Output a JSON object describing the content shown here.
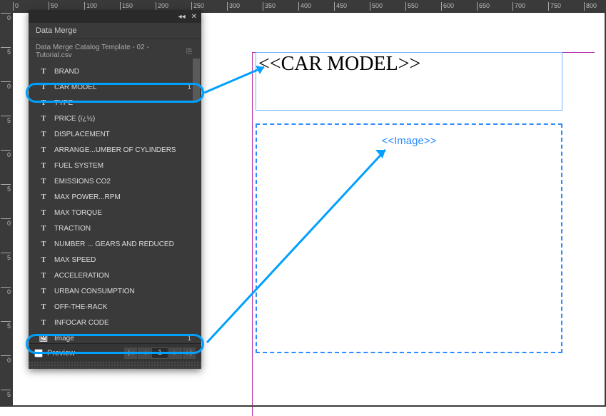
{
  "panel": {
    "title": "Data Merge",
    "source": "Data Merge Catalog Template - 02 - Tutorial.csv",
    "menu_icon": "▾≡",
    "close_icon": "✕",
    "collapse_icon": "◂◂",
    "source_icon": "⎘"
  },
  "fields": [
    {
      "type": "text",
      "label": "BRAND",
      "count": ""
    },
    {
      "type": "text",
      "label": "CAR MODEL",
      "count": "1"
    },
    {
      "type": "text",
      "label": "TYPE",
      "count": ""
    },
    {
      "type": "text",
      "label": "PRICE (ï¿½)",
      "count": ""
    },
    {
      "type": "text",
      "label": "DISPLACEMENT",
      "count": ""
    },
    {
      "type": "text",
      "label": "ARRANGE...UMBER OF CYLINDERS",
      "count": ""
    },
    {
      "type": "text",
      "label": "FUEL SYSTEM",
      "count": ""
    },
    {
      "type": "text",
      "label": "EMISSIONS CO2",
      "count": ""
    },
    {
      "type": "text",
      "label": "MAX POWER...RPM",
      "count": ""
    },
    {
      "type": "text",
      "label": "MAX TORQUE",
      "count": ""
    },
    {
      "type": "text",
      "label": "TRACTION",
      "count": ""
    },
    {
      "type": "text",
      "label": "NUMBER ... GEARS AND REDUCED",
      "count": ""
    },
    {
      "type": "text",
      "label": "MAX SPEED",
      "count": ""
    },
    {
      "type": "text",
      "label": "ACCELERATION",
      "count": ""
    },
    {
      "type": "text",
      "label": "URBAN CONSUMPTION",
      "count": ""
    },
    {
      "type": "text",
      "label": "OFF-THE-RACK",
      "count": ""
    },
    {
      "type": "text",
      "label": "INFOCAR CODE",
      "count": ""
    },
    {
      "type": "image",
      "label": "Image",
      "count": "1"
    }
  ],
  "footer": {
    "preview_label": "Preview",
    "nav_first": "|◂",
    "nav_prev": "◂",
    "page": "1",
    "nav_next": "▸",
    "nav_last": "▸|"
  },
  "ruler_h": [
    "0",
    "50",
    "100",
    "150",
    "200",
    "250",
    "300",
    "350",
    "400",
    "450",
    "500",
    "550",
    "600",
    "650",
    "700",
    "750",
    "800"
  ],
  "ruler_v": [
    "0",
    "5",
    "0",
    "5",
    "0",
    "5",
    "0",
    "5",
    "0",
    "5",
    "0",
    "5"
  ],
  "canvas": {
    "placeholder_text": "<<CAR MODEL>>",
    "placeholder_image": "<<Image>>"
  }
}
